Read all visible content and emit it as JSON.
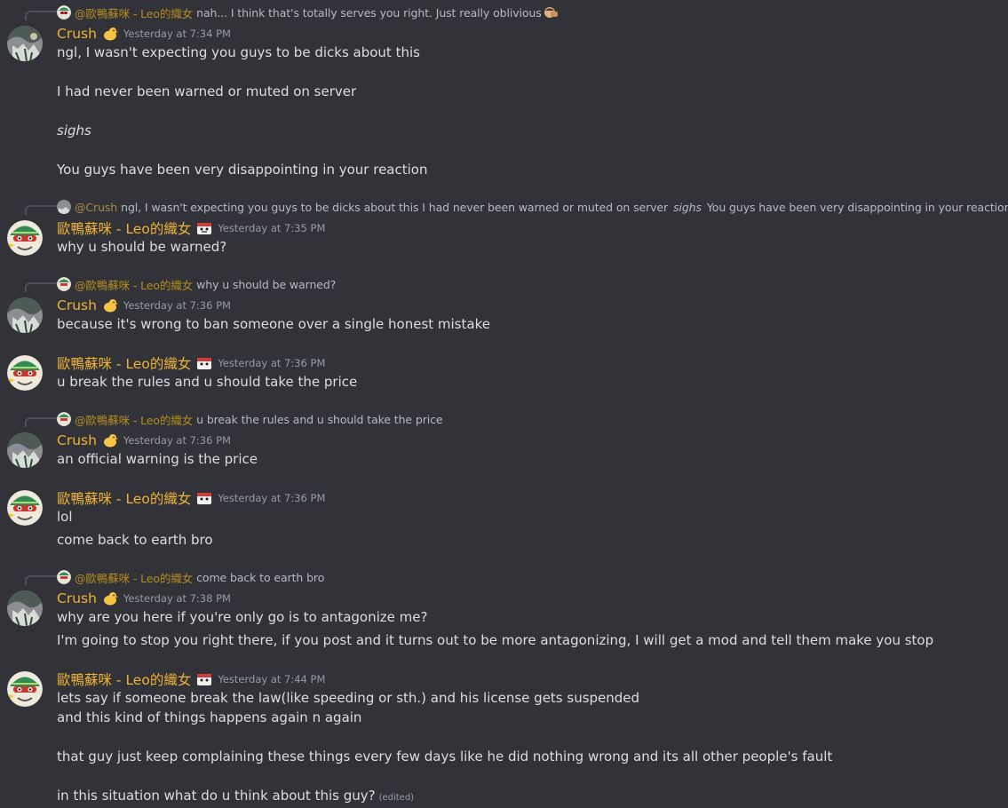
{
  "messages": [
    {
      "reply": {
        "name": "@歐鴨蘇咪 - Leo的織女",
        "text": "nah... I think that's totally serves you right. Just really oblivious"
      },
      "author": "Crush",
      "time": "Yesterday at 7:34 PM",
      "lines": [
        "ngl, I wasn't expecting you guys to be dicks about this",
        "I had never been warned or muted on server",
        "sighs",
        "You guys have been very disappointing in your reaction"
      ]
    },
    {
      "reply": {
        "name": "@Crush",
        "text_a": "ngl, I wasn't expecting you guys to be dicks about this  I had never been warned or muted on server",
        "text_em": "sighs",
        "text_b": "You guys have been very disappointing in your reaction"
      },
      "author": "歐鴨蘇咪 - Leo的織女",
      "time": "Yesterday at 7:35 PM",
      "lines": [
        "why u should be warned?"
      ]
    },
    {
      "reply": {
        "name": "@歐鴨蘇咪 - Leo的織女",
        "text": "why u should be warned?"
      },
      "author": "Crush",
      "time": "Yesterday at 7:36 PM",
      "lines": [
        "because it's wrong to ban someone over a single honest mistake"
      ]
    },
    {
      "author": "歐鴨蘇咪 - Leo的織女",
      "time": "Yesterday at 7:36 PM",
      "lines": [
        "u break the rules and u should take the price"
      ]
    },
    {
      "reply": {
        "name": "@歐鴨蘇咪 - Leo的織女",
        "text": "u break the rules and u should take the price"
      },
      "author": "Crush",
      "time": "Yesterday at 7:36 PM",
      "lines": [
        "an official warning is the price"
      ]
    },
    {
      "author": "歐鴨蘇咪 - Leo的織女",
      "time": "Yesterday at 7:36 PM",
      "lines": [
        "lol",
        "come back to earth bro"
      ]
    },
    {
      "reply": {
        "name": "@歐鴨蘇咪 - Leo的織女",
        "text": "come back to earth bro"
      },
      "author": "Crush",
      "time": "Yesterday at 7:38 PM",
      "lines": [
        "why are you here if you're only go is to antagonize me?",
        "I'm going to stop you right there, if you post and it turns out to be more antagonizing, I will get a mod and tell them make you stop"
      ]
    },
    {
      "author": "歐鴨蘇咪 - Leo的織女",
      "time": "Yesterday at 7:44 PM",
      "lines": [
        "lets say if someone break the law(like speeding or sth.) and his license gets suspended",
        "and this kind of things happens again n again",
        "that guy just keep complaining these things every few days like he did nothing wrong and its all other people's fault",
        "in this situation what do u think about this guy?"
      ],
      "edited": "(edited)"
    }
  ],
  "colors": {
    "background": "#313338",
    "username": "#f0b232",
    "timestamp": "#949ba4",
    "text": "#dbdee1"
  }
}
